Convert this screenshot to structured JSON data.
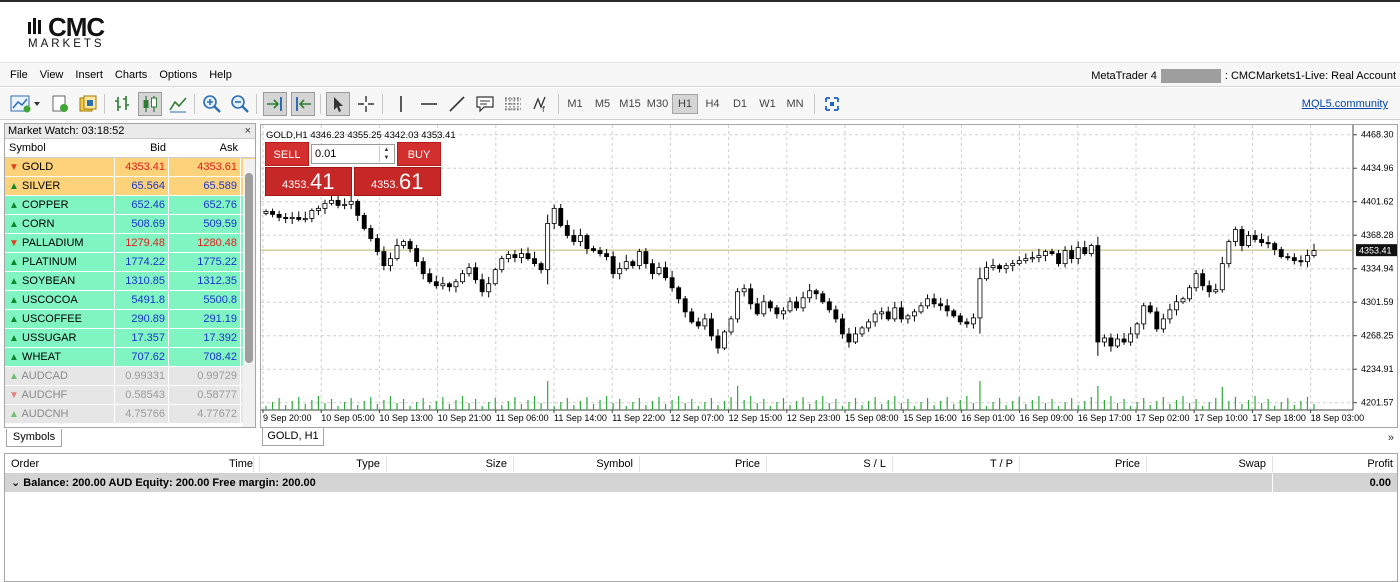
{
  "brand": {
    "name": "CMC",
    "sub": "MARKETS"
  },
  "menu": [
    "File",
    "View",
    "Insert",
    "Charts",
    "Options",
    "Help"
  ],
  "account": {
    "platform": "MetaTrader 4",
    "server": ": CMCMarkets1-Live: Real Account"
  },
  "toolbar": {
    "timeframes": [
      "M1",
      "M5",
      "M15",
      "M30",
      "H1",
      "H4",
      "D1",
      "W1",
      "MN"
    ],
    "active_timeframe": "H1",
    "community_link": "MQL5.community"
  },
  "market_watch": {
    "title": "Market Watch: 03:18:52",
    "close": "×",
    "columns": [
      "Symbol",
      "Bid",
      "Ask"
    ],
    "rows": [
      {
        "symbol": "GOLD",
        "bid": "4353.41",
        "ask": "4353.61",
        "dir": "down",
        "bg": "#fcd37a",
        "bidColor": "#e21e1e",
        "askColor": "#e21e1e"
      },
      {
        "symbol": "SILVER",
        "bid": "65.564",
        "ask": "65.589",
        "dir": "up",
        "bg": "#fcd37a",
        "bidColor": "#1a33cc",
        "askColor": "#1a33cc"
      },
      {
        "symbol": "COPPER",
        "bid": "652.46",
        "ask": "652.76",
        "dir": "up",
        "bg": "#80f5c2",
        "bidColor": "#1a33cc",
        "askColor": "#1a33cc"
      },
      {
        "symbol": "CORN",
        "bid": "508.69",
        "ask": "509.59",
        "dir": "up",
        "bg": "#80f5c2",
        "bidColor": "#1a33cc",
        "askColor": "#1a33cc"
      },
      {
        "symbol": "PALLADIUM",
        "bid": "1279.48",
        "ask": "1280.48",
        "dir": "down",
        "bg": "#80f5c2",
        "bidColor": "#e21e1e",
        "askColor": "#e21e1e"
      },
      {
        "symbol": "PLATINUM",
        "bid": "1774.22",
        "ask": "1775.22",
        "dir": "up",
        "bg": "#80f5c2",
        "bidColor": "#1a33cc",
        "askColor": "#1a33cc"
      },
      {
        "symbol": "SOYBEAN",
        "bid": "1310.85",
        "ask": "1312.35",
        "dir": "up",
        "bg": "#80f5c2",
        "bidColor": "#1a33cc",
        "askColor": "#1a33cc"
      },
      {
        "symbol": "USCOCOA",
        "bid": "5491.8",
        "ask": "5500.8",
        "dir": "up",
        "bg": "#80f5c2",
        "bidColor": "#1a33cc",
        "askColor": "#1a33cc"
      },
      {
        "symbol": "USCOFFEE",
        "bid": "290.89",
        "ask": "291.19",
        "dir": "up",
        "bg": "#80f5c2",
        "bidColor": "#1a33cc",
        "askColor": "#1a33cc"
      },
      {
        "symbol": "USSUGAR",
        "bid": "17.357",
        "ask": "17.392",
        "dir": "up",
        "bg": "#80f5c2",
        "bidColor": "#1a33cc",
        "askColor": "#1a33cc"
      },
      {
        "symbol": "WHEAT",
        "bid": "707.62",
        "ask": "708.42",
        "dir": "up",
        "bg": "#80f5c2",
        "bidColor": "#1a33cc",
        "askColor": "#1a33cc"
      },
      {
        "symbol": "AUDCAD",
        "bid": "0.99331",
        "ask": "0.99729",
        "dir": "up",
        "bg": "#e6e6e6",
        "bidColor": "#9a9a9a",
        "askColor": "#9a9a9a",
        "muted": true
      },
      {
        "symbol": "AUDCHF",
        "bid": "0.58543",
        "ask": "0.58777",
        "dir": "down",
        "bg": "#e6e6e6",
        "bidColor": "#9a9a9a",
        "askColor": "#9a9a9a",
        "muted": true
      },
      {
        "symbol": "AUDCNH",
        "bid": "4.75766",
        "ask": "4.77672",
        "dir": "up",
        "bg": "#e6e6e6",
        "bidColor": "#9a9a9a",
        "askColor": "#9a9a9a",
        "muted": true
      }
    ],
    "tab": "Symbols"
  },
  "chart": {
    "header": "GOLD,H1  4346.23 4355.25 4342.03 4353.41",
    "tab": "GOLD, H1",
    "trade": {
      "sell_label": "SELL",
      "buy_label": "BUY",
      "lot": "0.01",
      "sell_small": "4353.",
      "sell_big": "41",
      "buy_small": "4353.",
      "buy_big": "61"
    },
    "current_price_label": "4353.41"
  },
  "chart_data": {
    "type": "candlestick",
    "y_ticks": [
      "4468.30",
      "4434.96",
      "4401.62",
      "4368.28",
      "4334.94",
      "4301.59",
      "4268.25",
      "4234.91",
      "4201.57"
    ],
    "ylim": [
      4194.3,
      4478.0
    ],
    "x_ticks": [
      "9 Sep 20:00",
      "10 Sep 05:00",
      "10 Sep 13:00",
      "10 Sep 21:00",
      "11 Sep 06:00",
      "11 Sep 14:00",
      "11 Sep 22:00",
      "12 Sep 07:00",
      "12 Sep 15:00",
      "12 Sep 23:00",
      "15 Sep 08:00",
      "15 Sep 16:00",
      "16 Sep 01:00",
      "16 Sep 09:00",
      "16 Sep 17:00",
      "17 Sep 02:00",
      "17 Sep 10:00",
      "17 Sep 18:00",
      "18 Sep 03:00"
    ],
    "current_price": 4353.41,
    "closes": [
      4392,
      4389,
      4386,
      4385,
      4386,
      4384,
      4385,
      4393,
      4395,
      4400,
      4403,
      4398,
      4399,
      4402,
      4388,
      4375,
      4365,
      4352,
      4338,
      4345,
      4358,
      4362,
      4355,
      4342,
      4330,
      4322,
      4318,
      4320,
      4317,
      4322,
      4330,
      4336,
      4324,
      4312,
      4320,
      4334,
      4345,
      4349,
      4346,
      4350,
      4345,
      4340,
      4334,
      4380,
      4395,
      4378,
      4368,
      4362,
      4368,
      4355,
      4353,
      4350,
      4347,
      4330,
      4335,
      4342,
      4338,
      4352,
      4340,
      4330,
      4336,
      4326,
      4316,
      4305,
      4292,
      4282,
      4278,
      4285,
      4268,
      4256,
      4272,
      4285,
      4312,
      4315,
      4300,
      4290,
      4302,
      4296,
      4290,
      4293,
      4302,
      4296,
      4306,
      4313,
      4310,
      4302,
      4294,
      4285,
      4270,
      4262,
      4270,
      4276,
      4282,
      4290,
      4292,
      4285,
      4296,
      4285,
      4288,
      4292,
      4298,
      4305,
      4300,
      4298,
      4293,
      4288,
      4282,
      4280,
      4286,
      4325,
      4336,
      4338,
      4335,
      4338,
      4340,
      4343,
      4345,
      4346,
      4348,
      4352,
      4350,
      4340,
      4353,
      4345,
      4356,
      4350,
      4358,
      4262,
      4266,
      4258,
      4265,
      4262,
      4270,
      4280,
      4298,
      4292,
      4275,
      4285,
      4294,
      4302,
      4305,
      4316,
      4330,
      4318,
      4312,
      4314,
      4340,
      4362,
      4374,
      4358,
      4368,
      4364,
      4361,
      4360,
      4354,
      4347,
      4346,
      4343,
      4342,
      4348,
      4353
    ]
  },
  "terminal": {
    "columns": [
      "Order",
      "Time",
      "Type",
      "Size",
      "Symbol",
      "Price",
      "S / L",
      "T / P",
      "Price",
      "Swap",
      "Profit"
    ],
    "balance": "Balance: 200.00 AUD  Equity: 200.00  Free margin: 200.00",
    "profit": "0.00"
  }
}
